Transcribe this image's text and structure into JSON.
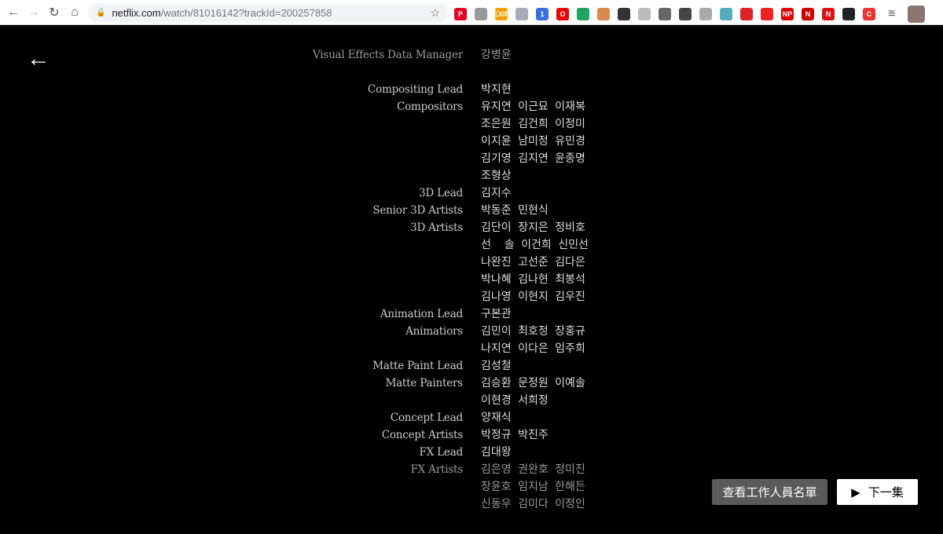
{
  "browser": {
    "url_host": "netflix.com",
    "url_path": "/watch/81016142?trackId=200257858",
    "extensions": [
      {
        "icon": "pinterest-icon",
        "color": "#e60023",
        "text": "P"
      },
      {
        "icon": "copy-icon",
        "color": "#999",
        "text": ""
      },
      {
        "icon": "exif-icon",
        "color": "#f0a000",
        "text": "EXIF"
      },
      {
        "icon": "image-icon",
        "color": "#aab",
        "text": ""
      },
      {
        "icon": "clock-icon",
        "color": "#3a6fd8",
        "text": "1"
      },
      {
        "icon": "opera-icon",
        "color": "#e00",
        "text": "O"
      },
      {
        "icon": "google-drive-icon",
        "color": "#1fa463",
        "text": ""
      },
      {
        "icon": "photo-icon",
        "color": "#d88a50",
        "text": ""
      },
      {
        "icon": "qr-code-icon",
        "color": "#333",
        "text": ""
      },
      {
        "icon": "link-icon",
        "color": "#bbb",
        "text": ""
      },
      {
        "icon": "film-icon",
        "color": "#666",
        "text": ""
      },
      {
        "icon": "face-icon",
        "color": "#444",
        "text": ""
      },
      {
        "icon": "download-icon",
        "color": "#aaa",
        "text": ""
      },
      {
        "icon": "edit-image-icon",
        "color": "#5ab",
        "text": ""
      },
      {
        "icon": "record-icon",
        "color": "#d22",
        "text": ""
      },
      {
        "icon": "youtube-icon",
        "color": "#e22",
        "text": ""
      },
      {
        "icon": "np-icon",
        "color": "#d00",
        "text": "NP"
      },
      {
        "icon": "n-icon",
        "color": "#c00",
        "text": "N"
      },
      {
        "icon": "netflix-icon",
        "color": "#d11",
        "text": "N"
      },
      {
        "icon": "bookmark-icon",
        "color": "#222",
        "text": ""
      },
      {
        "icon": "c-icon",
        "color": "#e33",
        "text": "C"
      }
    ]
  },
  "credits": [
    {
      "role": "Visual Effects Data Manager",
      "names": "강병윤",
      "dim": true
    },
    {
      "role": "Compositing Lead",
      "names": "박지현"
    },
    {
      "role": "Compositors",
      "names": "유지연 이근묘 이재복"
    },
    {
      "role": "",
      "names": "조은원 김건희 이정미"
    },
    {
      "role": "",
      "names": "이지윤 남미정 유민경"
    },
    {
      "role": "",
      "names": "김기영 김지연 윤종명"
    },
    {
      "role": "",
      "names": "조형상"
    },
    {
      "role": "3D Lead",
      "names": "김지수"
    },
    {
      "role": "Senior 3D Artists",
      "names": "박동준 민현식"
    },
    {
      "role": "3D Artists",
      "names": "김단이 장지은 정비호"
    },
    {
      "role": "",
      "names": "선  솔 이건희 신민선"
    },
    {
      "role": "",
      "names": "나완진 고선준 김다은"
    },
    {
      "role": "",
      "names": "박나혜 김나현 최봉석"
    },
    {
      "role": "",
      "names": "김나영 이현지 김우진"
    },
    {
      "role": "Animation Lead",
      "names": "구본관"
    },
    {
      "role": "Animatiors",
      "names": "김민이 최호정 장홍규"
    },
    {
      "role": "",
      "names": "나지연 이다은 임주희"
    },
    {
      "role": "Matte Paint Lead",
      "names": "김성철"
    },
    {
      "role": "Matte Painters",
      "names": "김승환 문정원 이예솔"
    },
    {
      "role": "",
      "names": "이현경 서희정"
    },
    {
      "role": "Concept Lead",
      "names": "양재식"
    },
    {
      "role": "Concept Artists",
      "names": "박정규 박진주"
    },
    {
      "role": "FX Lead",
      "names": "김대왕"
    },
    {
      "role": "FX Artists",
      "names": "김은영 권완호 정미진",
      "dim": true
    },
    {
      "role": "",
      "names": "장윤호 임지남 한해든",
      "dim": true
    },
    {
      "role": "",
      "names": "신동우 김미다 이정인",
      "dim": true
    }
  ],
  "buttons": {
    "view_credits": "查看工作人員名單",
    "next_episode": "下一集"
  }
}
